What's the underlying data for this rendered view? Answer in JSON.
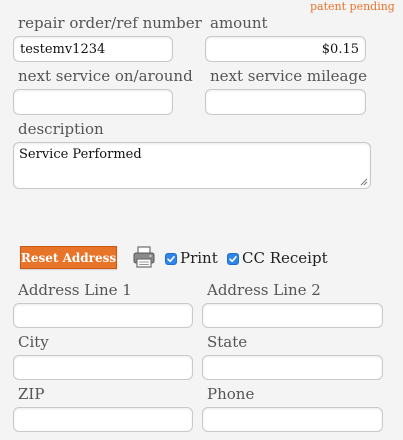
{
  "patent_text": "patent pending",
  "repair_order": {
    "label": "repair order/ref number",
    "value": "testemv1234"
  },
  "amount": {
    "label": "amount",
    "value": "$0.15"
  },
  "next_service_on": {
    "label": "next service on/around",
    "value": ""
  },
  "next_service_mileage": {
    "label": "next service mileage",
    "value": ""
  },
  "description": {
    "label": "description",
    "value": "Service Performed"
  },
  "reset_address_button": "Reset Address",
  "print_icon": "printer-icon",
  "print_option": {
    "label": "Print",
    "checked": true
  },
  "cc_receipt_option": {
    "label": "CC Receipt",
    "checked": true
  },
  "address_line_1": {
    "label": "Address Line 1",
    "value": ""
  },
  "address_line_2": {
    "label": "Address Line 2",
    "value": ""
  },
  "city": {
    "label": "City",
    "value": ""
  },
  "state": {
    "label": "State",
    "value": ""
  },
  "zip": {
    "label": "ZIP",
    "value": ""
  },
  "phone": {
    "label": "Phone",
    "value": ""
  },
  "colors": {
    "accent": "#e8742a",
    "checkbox": "#2f86e8",
    "background": "#f4f4f4"
  }
}
